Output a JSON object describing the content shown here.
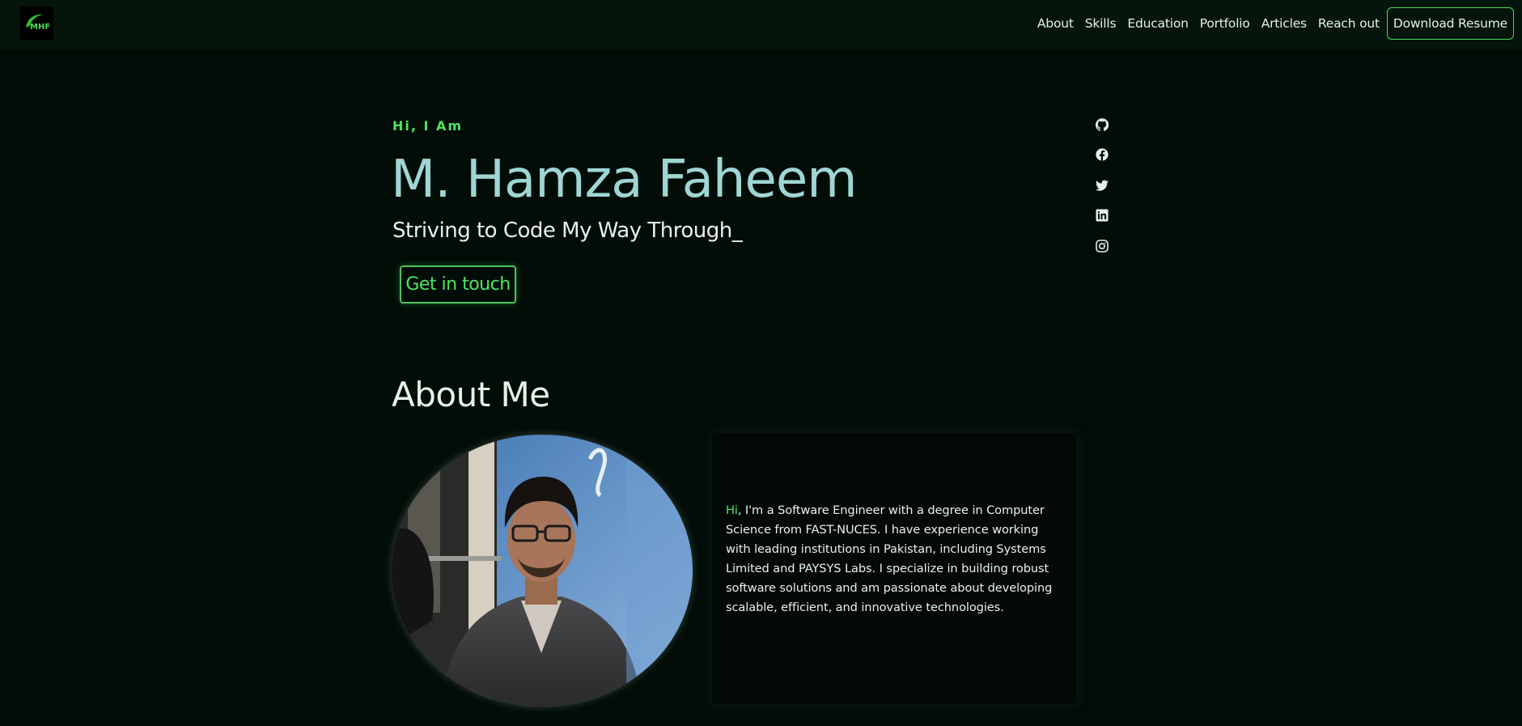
{
  "nav": {
    "logo_text": "MHF",
    "links": [
      "About",
      "Skills",
      "Education",
      "Portfolio",
      "Articles",
      "Reach out"
    ],
    "resume_button": "Download Resume"
  },
  "hero": {
    "greeting": "Hi, I Am",
    "name": "M. Hamza Faheem",
    "tagline": "Striving to Code My Way Through_",
    "cta": "Get in touch"
  },
  "socials": [
    "github-icon",
    "facebook-icon",
    "twitter-icon",
    "linkedin-icon",
    "instagram-icon"
  ],
  "about": {
    "title": "About Me",
    "text_accent": "Hi",
    "text_rest": ", I'm a Software Engineer with a degree in Computer Science from FAST-NUCES. I have experience working with leading institutions in Pakistan, including Systems Limited and PAYSYS Labs. I specialize in building robust software solutions and am passionate about developing scalable, efficient, and innovative technologies."
  },
  "colors": {
    "background": "#030d08",
    "accent": "#4ee45e",
    "name": "#9fd6d4"
  }
}
